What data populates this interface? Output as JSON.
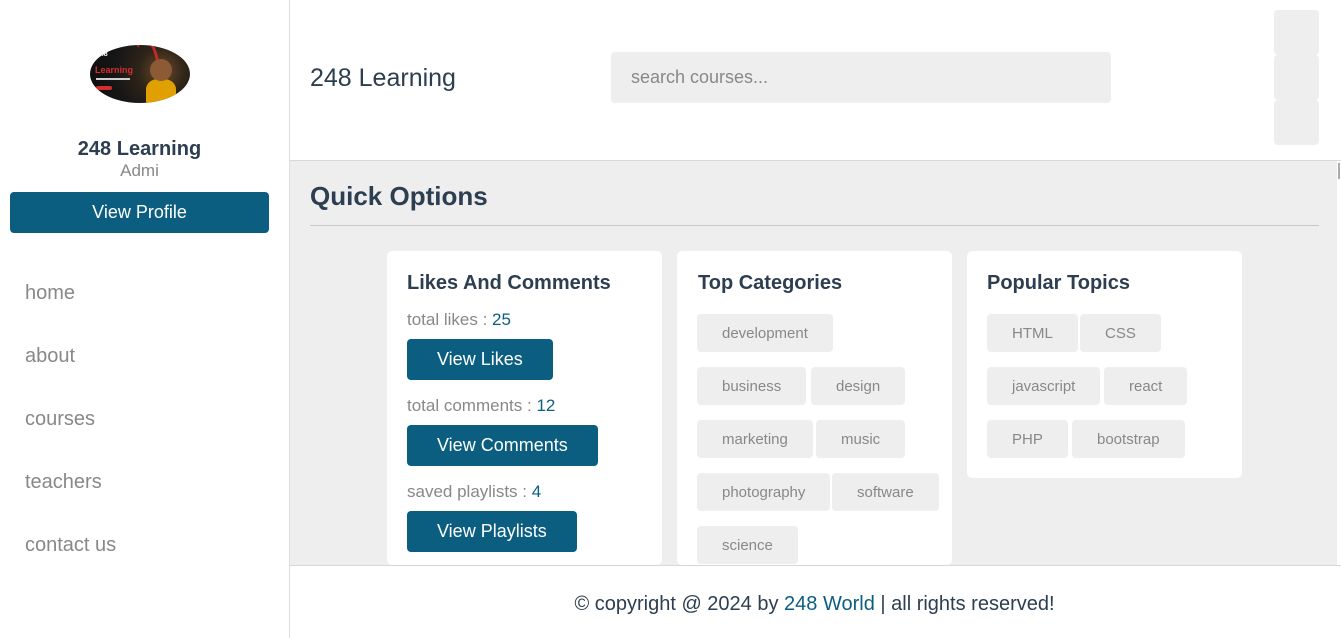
{
  "sidebar": {
    "profile": {
      "name": "248 Learning",
      "role": "Admi",
      "view_profile_label": "View Profile"
    },
    "nav": [
      "home",
      "about",
      "courses",
      "teachers",
      "contact us"
    ]
  },
  "header": {
    "title": "248 Learning",
    "search_placeholder": "search courses...",
    "icons": [
      "menu-icon",
      "search-icon",
      "user-icon"
    ]
  },
  "main": {
    "section_title": "Quick Options",
    "likes_card": {
      "title": "Likes And Comments",
      "likes_label": "total likes : ",
      "likes_value": "25",
      "view_likes_label": "View Likes",
      "comments_label": "total comments : ",
      "comments_value": "12",
      "view_comments_label": "View Comments",
      "playlists_label": "saved playlists : ",
      "playlists_value": "4",
      "view_playlists_label": "View Playlists"
    },
    "categories_card": {
      "title": "Top Categories",
      "tags": [
        "development",
        "business",
        "design",
        "marketing",
        "music",
        "photography",
        "software",
        "science"
      ]
    },
    "topics_card": {
      "title": "Popular Topics",
      "tags": [
        "HTML",
        "CSS",
        "javascript",
        "react",
        "PHP",
        "bootstrap"
      ]
    }
  },
  "footer": {
    "prefix": "© copyright @ 2024 by ",
    "link": "248 World",
    "suffix": " | all rights reserved!"
  },
  "avatar_image": {
    "number": "248",
    "word": "Learning"
  },
  "colors": {
    "accent": "#0b5e80",
    "background": "#eeeeee",
    "heading": "#2c3e50",
    "muted": "#888888"
  }
}
